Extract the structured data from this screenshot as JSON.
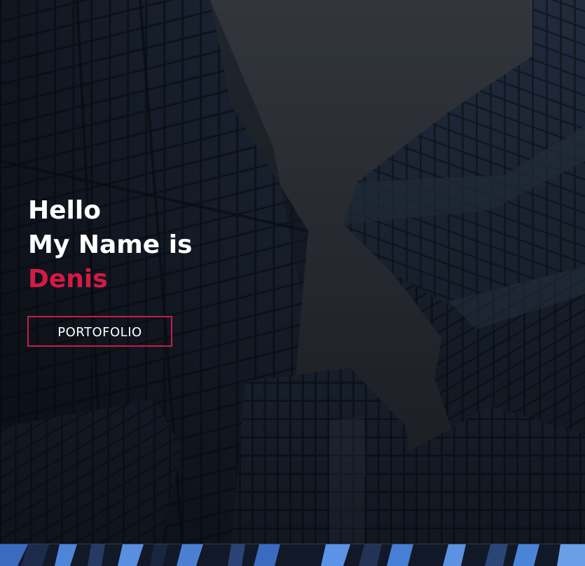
{
  "hero": {
    "greeting": "Hello",
    "intro": "My Name is",
    "name": "Denis",
    "button_label": "PORTOFOLIO"
  },
  "colors": {
    "accent": "#d51a45",
    "text": "#ffffff",
    "sky": "#3a3d44",
    "building": "#1f2837"
  }
}
